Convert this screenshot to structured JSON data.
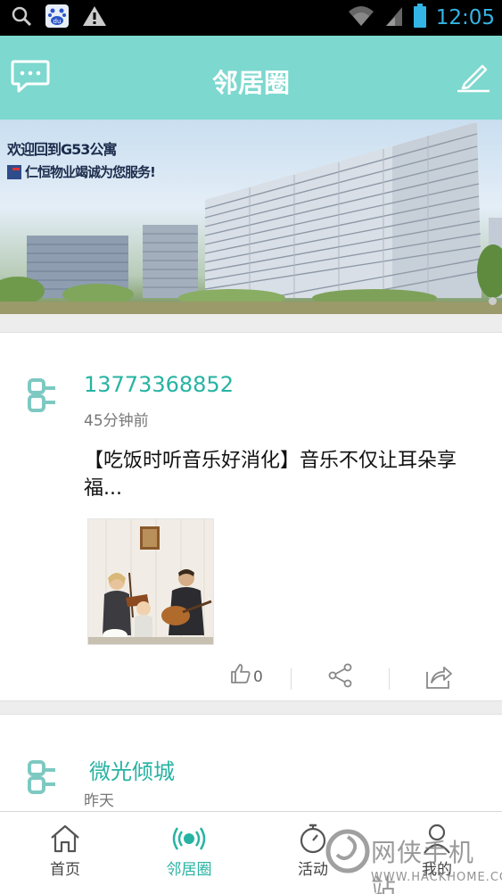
{
  "status_bar": {
    "time": "12:05",
    "icons": [
      "search-icon",
      "baidu-icon",
      "warning-icon",
      "wifi-icon",
      "signal-icon",
      "battery-icon"
    ]
  },
  "header": {
    "title": "邻居圈",
    "left_icon": "chat-bubble-icon",
    "right_icon": "edit-pencil-icon"
  },
  "banner": {
    "line1": "欢迎回到G53公寓",
    "line2": "仁恒物业竭诚为您服务!"
  },
  "posts": [
    {
      "user": "13773368852",
      "time": "45分钟前",
      "text": "【吃饭时听音乐好消化】音乐不仅让耳朵享福...",
      "likes": "0",
      "image": "family-music-photo"
    },
    {
      "user": "微光倾城",
      "time": "昨天"
    }
  ],
  "tabs": [
    {
      "label": "首页",
      "icon": "home-icon",
      "active": false
    },
    {
      "label": "邻居圈",
      "icon": "broadcast-icon",
      "active": true
    },
    {
      "label": "活动",
      "icon": "stopwatch-icon",
      "active": false
    },
    {
      "label": "我的",
      "icon": "person-icon",
      "active": false
    }
  ],
  "watermark": {
    "text": "网侠手机站",
    "sub": "WWW.HACKHOME.COM"
  },
  "colors": {
    "accent": "#7dd8cf",
    "accent_text": "#27b3a2",
    "status_blue": "#33b5e5"
  }
}
